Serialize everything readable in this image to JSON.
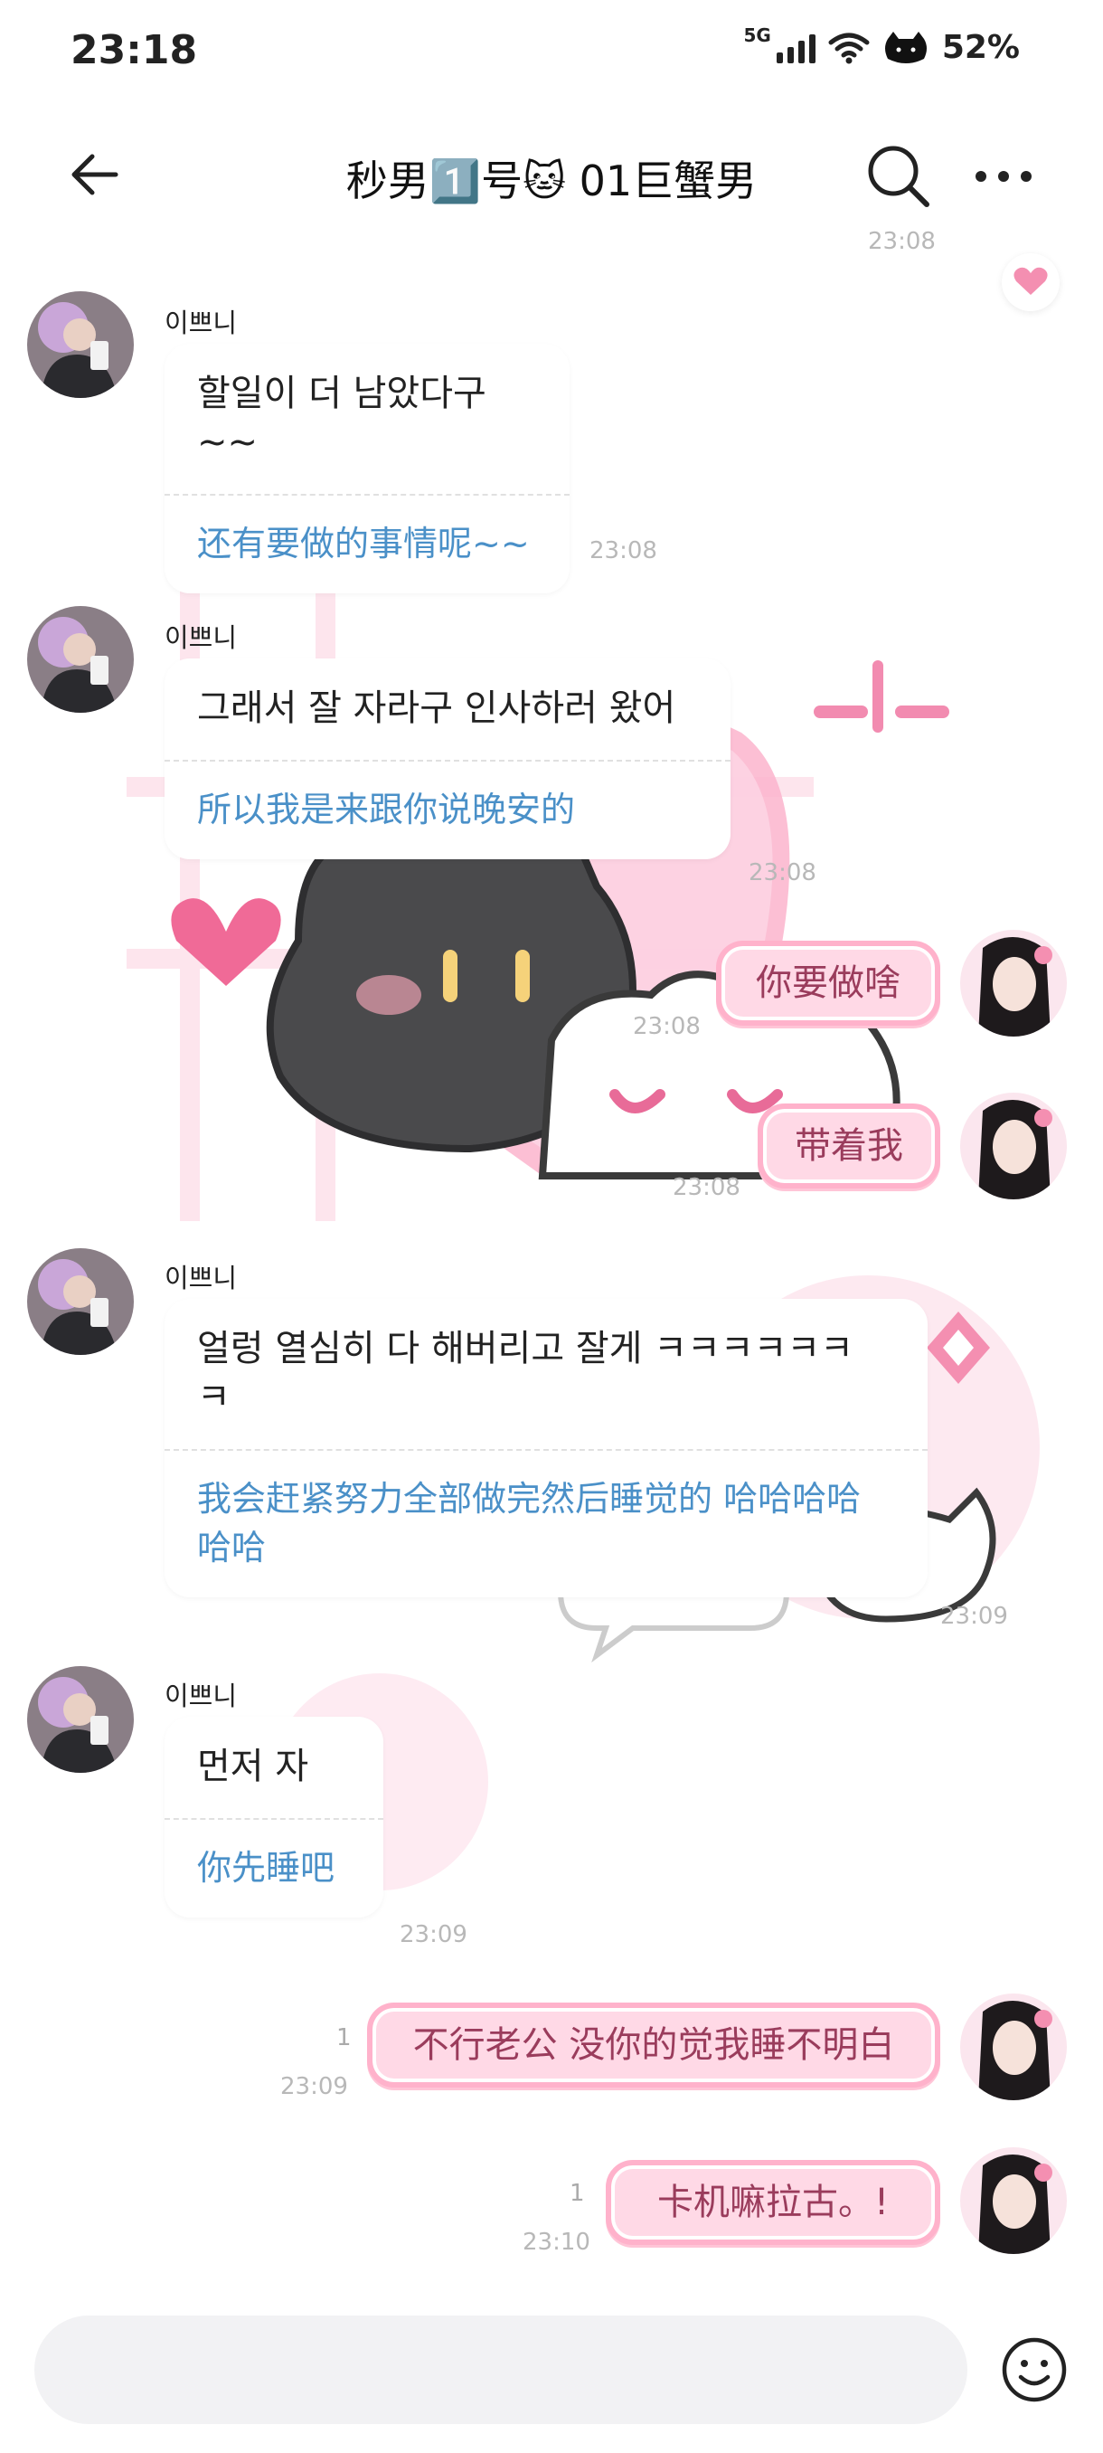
{
  "status": {
    "time": "23:18",
    "network": "5G",
    "battery": "52%"
  },
  "header": {
    "title": "秒男1️⃣号🐱 01巨蟹男"
  },
  "top_timestamp": "23:08",
  "messages": [
    {
      "sender": "이쁘니",
      "original": "할일이 더 남았다구~~",
      "translation": "还有要做的事情呢~~",
      "time": "23:08"
    },
    {
      "sender": "이쁘니",
      "original": "그래서 잘 자라구 인사하러 왔어",
      "translation": "所以我是来跟你说晚安的",
      "time": "23:08"
    },
    {
      "self": true,
      "text": "你要做啥",
      "time": "23:08"
    },
    {
      "self": true,
      "text": "带着我",
      "time": "23:08"
    },
    {
      "sender": "이쁘니",
      "original": "얼렁 열심히 다 해버리고 잘게 ㅋㅋㅋㅋㅋㅋ ㅋ",
      "translation": "我会赶紧努力全部做完然后睡觉的 哈哈哈哈哈哈",
      "time": "23:09"
    },
    {
      "sender": "이쁘니",
      "original": "먼저 자",
      "translation": "你先睡吧",
      "time": "23:09"
    },
    {
      "self": true,
      "text": "不行老公 没你的觉我睡不明白",
      "time": "23:09",
      "unread": "1"
    },
    {
      "self": true,
      "text": "卡机嘛拉古。!",
      "time": "23:10",
      "unread": "1"
    }
  ],
  "icons": {
    "back": "back-arrow-icon",
    "search": "search-icon",
    "more": "more-icon",
    "emoji": "emoji-icon"
  },
  "colors": {
    "translation": "#4a90c8",
    "self_bubble": "#ffd9e6",
    "self_border": "#ffb2cb"
  }
}
